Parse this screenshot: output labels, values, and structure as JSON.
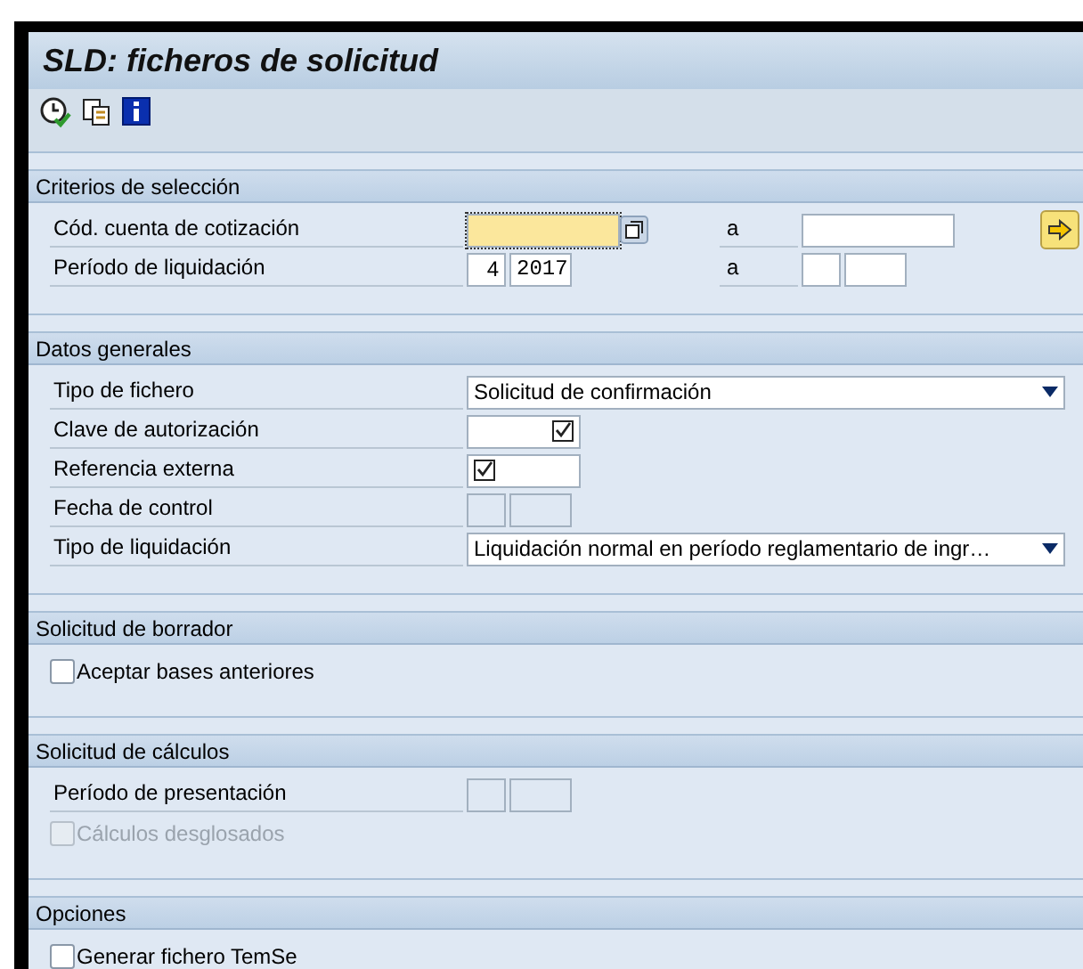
{
  "window": {
    "title": "SLD: ficheros de solicitud"
  },
  "toolbar": [
    {
      "kind": "execute"
    },
    {
      "kind": "copy"
    },
    {
      "kind": "info"
    }
  ],
  "sections": [
    {
      "title": "Criterios de selección",
      "rows": [
        {
          "kind": "range",
          "label": "Cód. cuenta de cotización",
          "from": "",
          "focused": true,
          "multi": true,
          "to_label": "a",
          "to": "",
          "action": true
        },
        {
          "kind": "period",
          "label": "Período de liquidación",
          "month": "4",
          "year": "2017",
          "disabled": false,
          "to_label": "a",
          "to_month": "",
          "to_year": ""
        }
      ]
    },
    {
      "title": "Datos generales",
      "rows": [
        {
          "kind": "select",
          "label": "Tipo de fichero",
          "value": "Solicitud de confirmación"
        },
        {
          "kind": "check-field",
          "label": "Clave de autorización",
          "check_first": false
        },
        {
          "kind": "check-field",
          "label": "Referencia externa",
          "check_first": true
        },
        {
          "kind": "period",
          "label": "Fecha de control",
          "month": "",
          "year": "",
          "disabled": true
        },
        {
          "kind": "select",
          "label": "Tipo de liquidación",
          "value": "Liquidación normal en período reglamentario de ingr…"
        }
      ]
    },
    {
      "title": "Solicitud de borrador",
      "rows": [
        {
          "kind": "checkbox",
          "label": "Aceptar bases anteriores",
          "checked": false,
          "disabled": false
        }
      ]
    },
    {
      "title": "Solicitud de cálculos",
      "rows": [
        {
          "kind": "period",
          "label": "Período de presentación",
          "month": "",
          "year": "",
          "disabled": true
        },
        {
          "kind": "checkbox",
          "label": "Cálculos desglosados",
          "checked": false,
          "disabled": true
        }
      ]
    },
    {
      "title": "Opciones",
      "rows": [
        {
          "kind": "checkbox",
          "label": "Generar fichero TemSe",
          "checked": false,
          "disabled": false
        }
      ]
    }
  ]
}
